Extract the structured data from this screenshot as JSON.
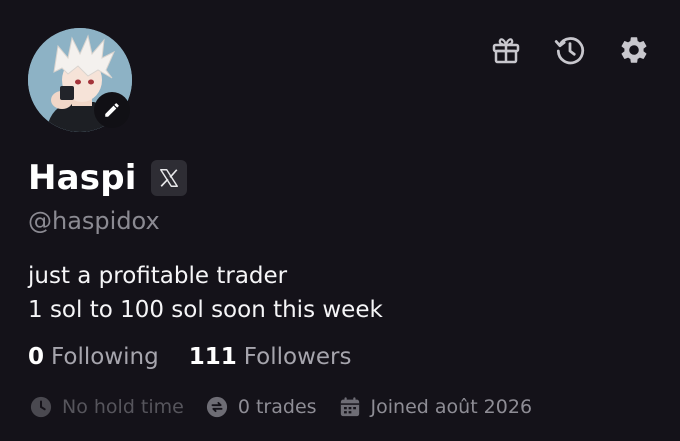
{
  "profile": {
    "name": "Haspi",
    "handle": "@haspidox",
    "bio_lines": [
      "just a profitable trader",
      "1 sol to 100 sol soon this week"
    ]
  },
  "social_badge": {
    "icon": "x-logo-icon"
  },
  "stats": {
    "following_count": "0",
    "following_label": "Following",
    "followers_count": "111",
    "followers_label": "Followers"
  },
  "meta": {
    "hold_time": "No hold time",
    "trades": "0 trades",
    "joined": "Joined août 2026"
  },
  "toolbar": {
    "icons": [
      "gift-icon",
      "history-icon",
      "settings-gear-icon"
    ]
  },
  "colors": {
    "background": "#141219",
    "text_primary": "#ffffff",
    "text_secondary": "#8b8a92",
    "badge_bg": "#2e2d34"
  }
}
